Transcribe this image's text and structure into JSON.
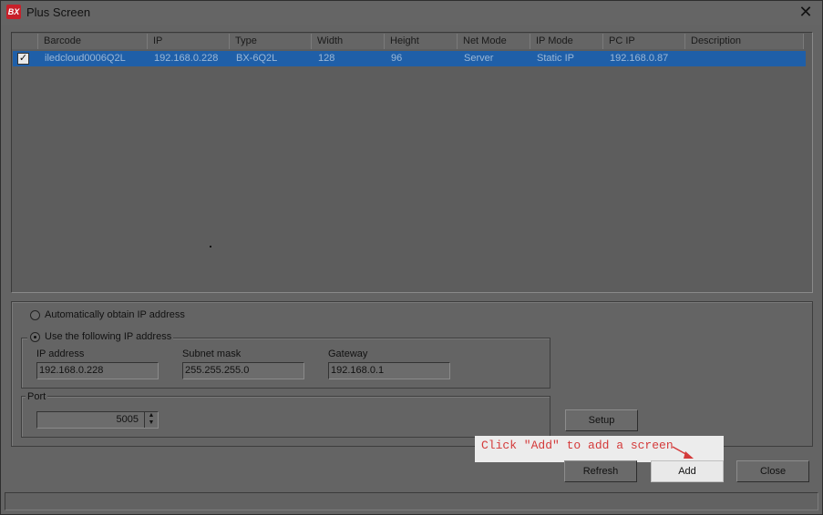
{
  "window": {
    "title": "Plus Screen",
    "icon_text": "BX",
    "close_glyph": "✕"
  },
  "table": {
    "columns": [
      "Barcode",
      "IP",
      "Type",
      "Width",
      "Height",
      "Net Mode",
      "IP Mode",
      "PC IP",
      "Description"
    ],
    "rows": [
      {
        "checked": true,
        "check_glyph": "✓",
        "cells": [
          "iledcloud0006Q2L",
          "192.168.0.228",
          "BX-6Q2L",
          "128",
          "96",
          "Server",
          "Static IP",
          "192.168.0.87",
          ""
        ]
      }
    ]
  },
  "ip_settings": {
    "auto_label": "Automatically obtain IP address",
    "manual_label": "Use the following IP address",
    "selected": "manual",
    "ip_label": "IP address",
    "ip_value": "192.168.0.228",
    "mask_label": "Subnet mask",
    "mask_value": "255.255.255.0",
    "gateway_label": "Gateway",
    "gateway_value": "192.168.0.1"
  },
  "port": {
    "label": "Port",
    "value": "5005",
    "up": "▲",
    "down": "▼"
  },
  "buttons": {
    "setup": "Setup",
    "refresh": "Refresh",
    "add": "Add",
    "close": "Close"
  },
  "annotation": {
    "text": "Click \"Add\" to add a screen",
    "color": "#d43a3a"
  }
}
